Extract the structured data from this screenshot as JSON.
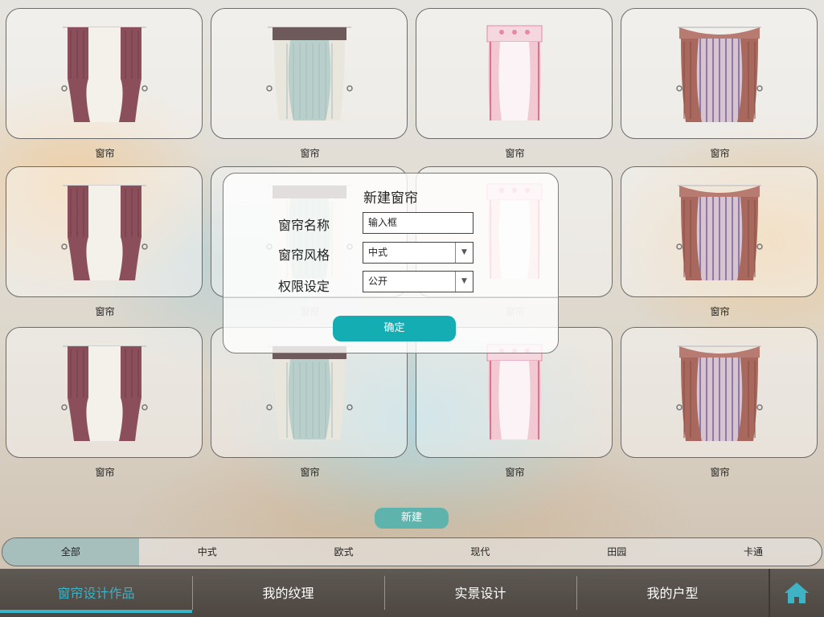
{
  "cards": [
    {
      "label": "窗帘",
      "style": "mauve"
    },
    {
      "label": "窗帘",
      "style": "lace"
    },
    {
      "label": "窗帘",
      "style": "pink"
    },
    {
      "label": "窗帘",
      "style": "striped"
    },
    {
      "label": "窗帘",
      "style": "mauve"
    },
    {
      "label": "窗帘",
      "style": "lace"
    },
    {
      "label": "窗帘",
      "style": "pink"
    },
    {
      "label": "窗帘",
      "style": "striped"
    },
    {
      "label": "窗帘",
      "style": "mauve"
    },
    {
      "label": "窗帘",
      "style": "lace"
    },
    {
      "label": "窗帘",
      "style": "pink"
    },
    {
      "label": "窗帘",
      "style": "striped"
    }
  ],
  "modal": {
    "title": "新建窗帘",
    "name_label": "窗帘名称",
    "name_value": "输入框",
    "style_label": "窗帘风格",
    "style_value": "中式",
    "permission_label": "权限设定",
    "permission_value": "公开",
    "confirm_label": "确定"
  },
  "new_button_label": "新建",
  "categories": [
    "全部",
    "中式",
    "欧式",
    "现代",
    "田园",
    "卡通"
  ],
  "active_category": "全部",
  "nav": {
    "tabs": [
      "窗帘设计作品",
      "我的纹理",
      "实景设计",
      "我的户型"
    ],
    "active_tab": "窗帘设计作品",
    "home_icon": "home-icon"
  },
  "colors": {
    "accent": "#15adb4",
    "active_tab": "#39b3c8",
    "nav_bg": "#57504b"
  }
}
